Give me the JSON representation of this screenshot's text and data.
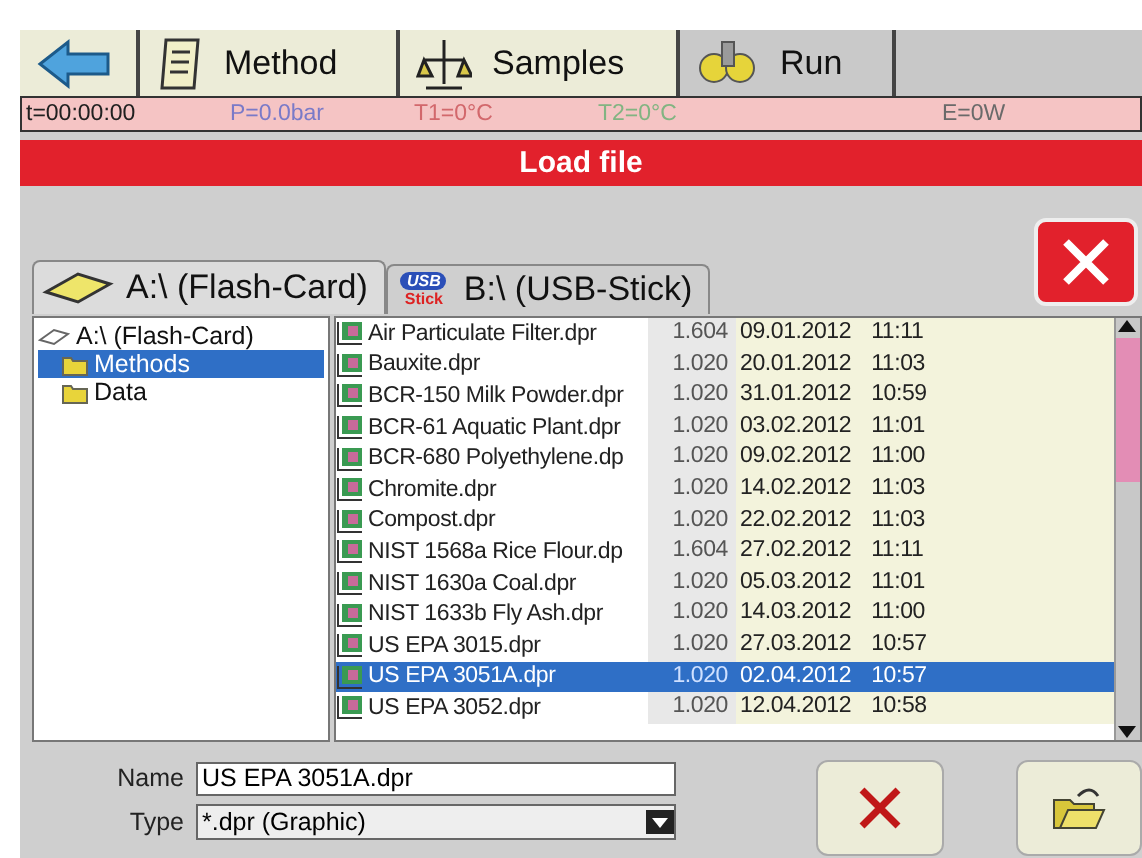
{
  "toolbar": [
    {
      "kind": "back",
      "selected": false
    },
    {
      "kind": "method",
      "label": "Method",
      "selected": false
    },
    {
      "kind": "samples",
      "label": "Samples",
      "selected": false
    },
    {
      "kind": "run",
      "label": "Run",
      "selected": true
    }
  ],
  "status_bar": [
    {
      "text": "t=00:00:00",
      "color": "#202020"
    },
    {
      "text": "P=0.0bar",
      "color": "#7a7ac8"
    },
    {
      "text": "T1=0°C",
      "color": "#d2686c"
    },
    {
      "text": "T2=0°C",
      "color": "#82b482"
    },
    {
      "text": "E=0W",
      "color": "#6a6a6a"
    }
  ],
  "dialog_title": "Load file",
  "drive_tabs": [
    {
      "kind": "flash",
      "label": "A:\\ (Flash-Card)",
      "selected": true
    },
    {
      "kind": "usb",
      "label": "B:\\ (USB-Stick)",
      "selected": false
    }
  ],
  "usb_icon_text": [
    "USB",
    "Stick"
  ],
  "tree": {
    "label": "A:\\ (Flash-Card)",
    "children": [
      {
        "label": "Methods",
        "selected": true
      },
      {
        "label": "Data",
        "selected": false
      }
    ]
  },
  "files": [
    {
      "name": "Air Particulate Filter.dpr",
      "version": "1.604",
      "date": "09.01.2012",
      "time": "11:11",
      "selected": false
    },
    {
      "name": "Bauxite.dpr",
      "version": "1.020",
      "date": "20.01.2012",
      "time": "11:03",
      "selected": false
    },
    {
      "name": "BCR-150 Milk Powder.dpr",
      "version": "1.020",
      "date": "31.01.2012",
      "time": "10:59",
      "selected": false
    },
    {
      "name": "BCR-61 Aquatic Plant.dpr",
      "version": "1.020",
      "date": "03.02.2012",
      "time": "11:01",
      "selected": false
    },
    {
      "name": "BCR-680 Polyethylene.dp",
      "version": "1.020",
      "date": "09.02.2012",
      "time": "11:00",
      "selected": false
    },
    {
      "name": "Chromite.dpr",
      "version": "1.020",
      "date": "14.02.2012",
      "time": "11:03",
      "selected": false
    },
    {
      "name": "Compost.dpr",
      "version": "1.020",
      "date": "22.02.2012",
      "time": "11:03",
      "selected": false
    },
    {
      "name": "NIST 1568a Rice Flour.dp",
      "version": "1.604",
      "date": "27.02.2012",
      "time": "11:11",
      "selected": false
    },
    {
      "name": "NIST 1630a Coal.dpr",
      "version": "1.020",
      "date": "05.03.2012",
      "time": "11:01",
      "selected": false
    },
    {
      "name": "NIST 1633b Fly Ash.dpr",
      "version": "1.020",
      "date": "14.03.2012",
      "time": "11:00",
      "selected": false
    },
    {
      "name": "US EPA 3015.dpr",
      "version": "1.020",
      "date": "27.03.2012",
      "time": "10:57",
      "selected": false
    },
    {
      "name": "US EPA 3051A.dpr",
      "version": "1.020",
      "date": "02.04.2012",
      "time": "10:57",
      "selected": true
    },
    {
      "name": "US EPA 3052.dpr",
      "version": "1.020",
      "date": "12.04.2012",
      "time": "10:58",
      "selected": false
    }
  ],
  "name_field": {
    "label": "Name",
    "value": "US EPA 3051A.dpr"
  },
  "type_field": {
    "label": "Type",
    "value": "*.dpr (Graphic)"
  }
}
